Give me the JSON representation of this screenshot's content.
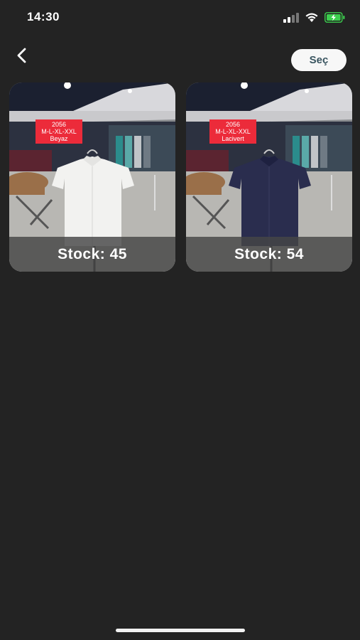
{
  "status_bar": {
    "time": "14:30"
  },
  "header": {
    "select_label": "Seç"
  },
  "products": [
    {
      "tag_lines": [
        "2056",
        "M-L-XL-XXL",
        "Beyaz"
      ],
      "stock_text": "Stock: 45",
      "shirt_color": "#f2f2f0"
    },
    {
      "tag_lines": [
        "2056",
        "M-L-XL-XXL",
        "Lacivert"
      ],
      "stock_text": "Stock: 54",
      "shirt_color": "#2a2d4e"
    }
  ],
  "colors": {
    "background": "#232323",
    "tag_red": "#ec2b3a",
    "battery_green": "#3ccf4e"
  }
}
